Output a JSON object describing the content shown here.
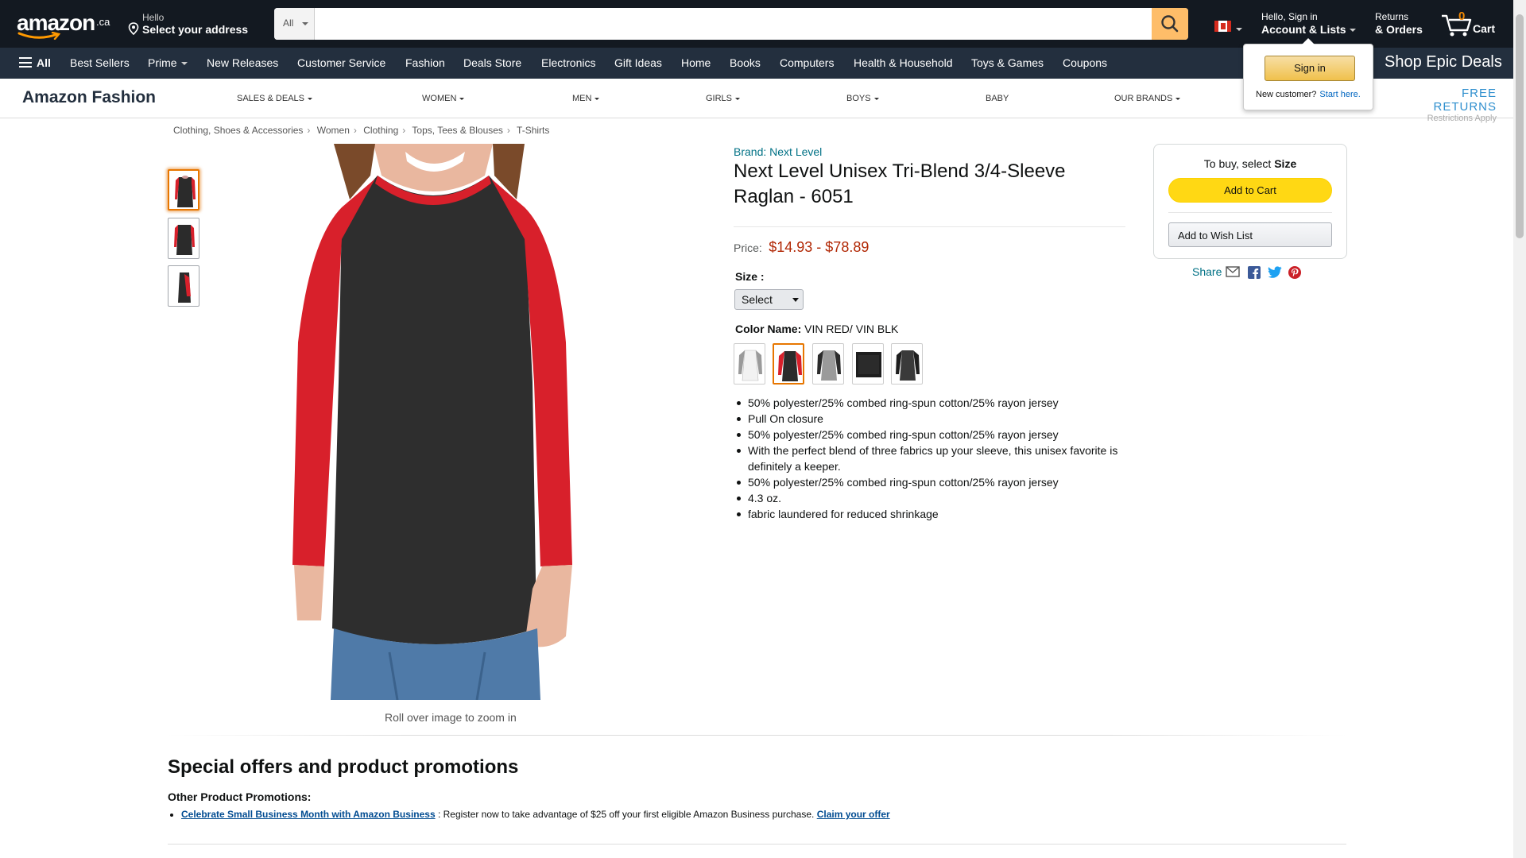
{
  "header": {
    "logo_text": "amazon",
    "logo_suffix": ".ca",
    "address_line1": "Hello",
    "address_line2": "Select your address",
    "search_category": "All",
    "search_placeholder": "",
    "account_line1": "Hello, Sign in",
    "account_line2": "Account & Lists",
    "returns_line1": "Returns",
    "returns_line2": "& Orders",
    "cart_count": "0",
    "cart_label": "Cart"
  },
  "nav": {
    "all_label": "All",
    "items": [
      "Best Sellers",
      "Prime",
      "New Releases",
      "Customer Service",
      "Fashion",
      "Deals Store",
      "Electronics",
      "Gift Ideas",
      "Home",
      "Books",
      "Computers",
      "Health & Household",
      "Toys & Games",
      "Coupons"
    ],
    "promo": "Shop Epic Deals"
  },
  "signin_flyout": {
    "button": "Sign in",
    "new_customer": "New customer?",
    "start_here": "Start here."
  },
  "fashion_nav": {
    "brand": "Amazon Fashion",
    "items": [
      "SALES & DEALS",
      "WOMEN",
      "MEN",
      "GIRLS",
      "BOYS",
      "BABY",
      "OUR BRANDS"
    ],
    "free_returns": "FREE RETURNS",
    "restrictions": "Restrictions Apply"
  },
  "breadcrumb": [
    "Clothing, Shoes & Accessories",
    "Women",
    "Clothing",
    "Tops, Tees & Blouses",
    "T-Shirts"
  ],
  "gallery": {
    "zoom_note": "Roll over image to zoom in"
  },
  "product": {
    "brand": "Brand: Next Level",
    "title": "Next Level Unisex Tri-Blend 3/4-Sleeve Raglan - 6051",
    "price_label": "Price:",
    "price_value": "$14.93 - $78.89",
    "size_label": "Size :",
    "size_selected": "Select",
    "color_label": "Color Name:",
    "color_value": "VIN RED/ VIN BLK",
    "bullets": [
      "50% polyester/25% combed ring-spun cotton/25% rayon jersey",
      "Pull On closure",
      "50% polyester/25% combed ring-spun cotton/25% rayon jersey",
      "With the perfect blend of three fabrics up your sleeve, this unisex favorite is definitely a keeper.",
      "50% polyester/25% combed ring-spun cotton/25% rayon jersey",
      "4.3 oz.",
      "fabric laundered for reduced shrinkage"
    ]
  },
  "buybox": {
    "to_buy_prefix": "To buy, select",
    "to_buy_bold": "Size",
    "add_to_cart": "Add to Cart",
    "add_to_wishlist": "Add to Wish List",
    "share": "Share"
  },
  "promotions": {
    "heading": "Special offers and product promotions",
    "subheading": "Other Product Promotions:",
    "link1": "Celebrate Small Business Month with Amazon Business",
    "text": " : Register now to take advantage of $25 off your first eligible Amazon Business purchase. ",
    "link2": "Claim your offer"
  },
  "colors": {
    "brand_dark": "#131921",
    "nav_dark": "#232f3e",
    "price": "#b12704",
    "link": "#007185",
    "cart_button": "#ffd814"
  }
}
